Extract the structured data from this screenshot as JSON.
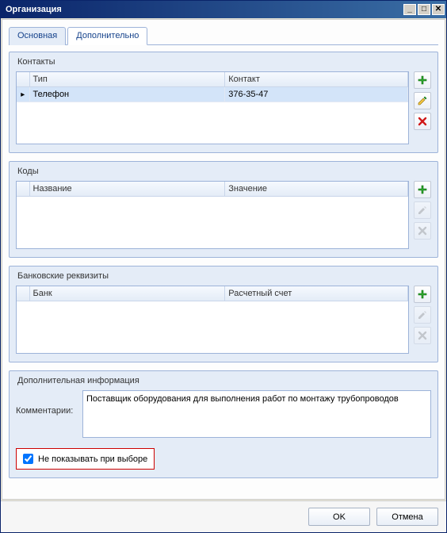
{
  "window": {
    "title": "Организация"
  },
  "tabs": {
    "main": "Основная",
    "extra": "Дополнительно"
  },
  "contacts": {
    "legend": "Контакты",
    "cols": {
      "type": "Тип",
      "contact": "Контакт"
    },
    "rows": [
      {
        "type": "Телефон",
        "contact": "376-35-47"
      }
    ]
  },
  "codes": {
    "legend": "Коды",
    "cols": {
      "name": "Название",
      "value": "Значение"
    },
    "rows": []
  },
  "bank": {
    "legend": "Банковские реквизиты",
    "cols": {
      "bank": "Банк",
      "account": "Расчетный счет"
    },
    "rows": []
  },
  "extraInfo": {
    "legend": "Дополнительная информация",
    "commentsLabel": "Комментарии:",
    "comments": "Поставщик оборудования для выполнения работ по монтажу трубопроводов",
    "hideCheckbox": "Не показывать при выборе",
    "hideChecked": true
  },
  "buttons": {
    "ok": "OK",
    "cancel": "Отмена"
  }
}
